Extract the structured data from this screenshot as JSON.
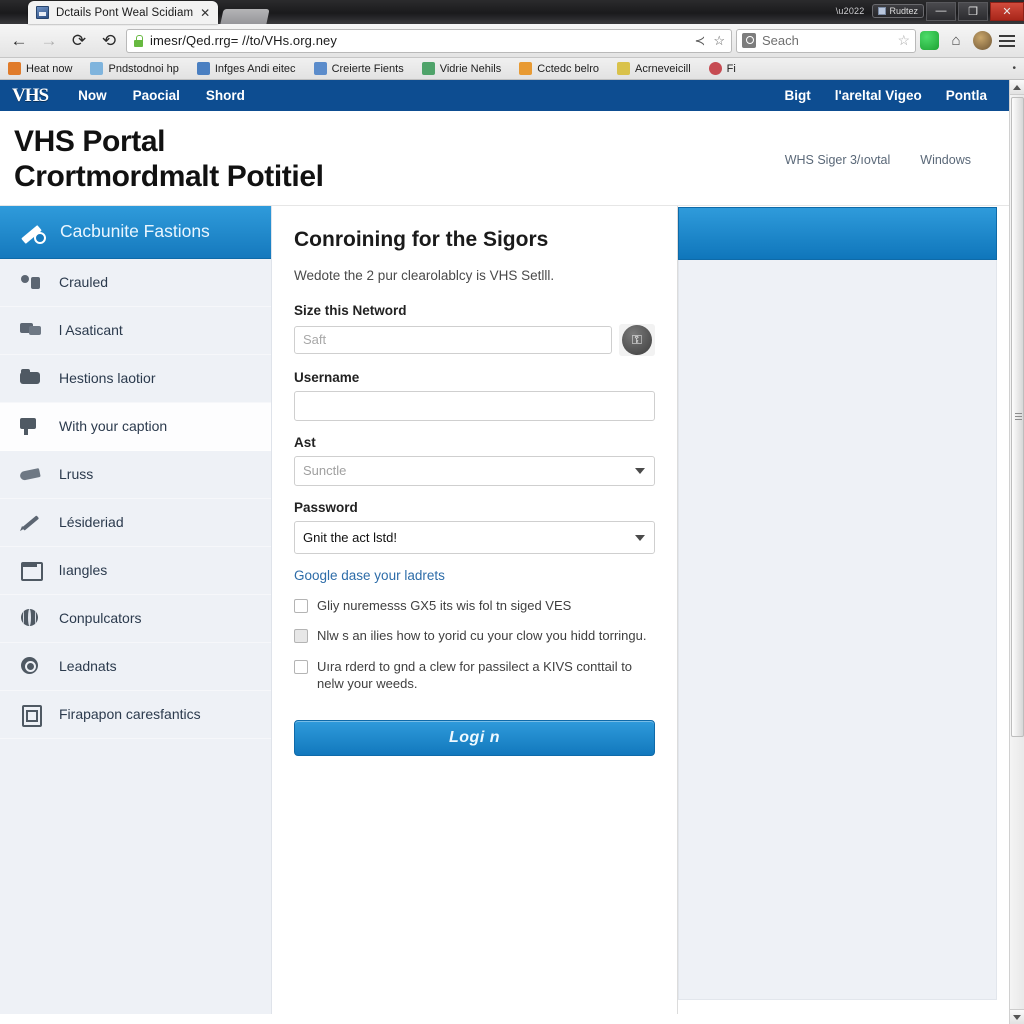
{
  "browser": {
    "tab": {
      "title": "Dctails Pont Weal Scidiam",
      "close_label": "✕",
      "favicon": "page-favicon"
    },
    "window_controls": {
      "status_text": "Rudtez",
      "minimize": "—",
      "maximize": "❐",
      "close": "✕"
    },
    "nav": {
      "back": "←",
      "forward": "→",
      "reload": "⟳",
      "stop": "⟲",
      "url": "imesr/Qed.rrg= //to/VHs.org.ney",
      "share": "≺",
      "bookmark_star": "☆"
    },
    "search": {
      "placeholder": "Seach",
      "value": "Seach",
      "star": "☆"
    },
    "toolbar_icons": [
      "shield-icon",
      "home-icon",
      "profile-icon",
      "menu-icon"
    ],
    "bookmarks": [
      {
        "label": "Heat now",
        "color": "#e07b2a"
      },
      {
        "label": "Pndstodnoi hp",
        "color": "#7fb4dd"
      },
      {
        "label": "Infges Andi eitec",
        "color": "#4a7fc1"
      },
      {
        "label": "Creierte Fients",
        "color": "#5b8ccb"
      },
      {
        "label": "Vidrie Nehils",
        "color": "#4fa36a"
      },
      {
        "label": "Cctedc belro",
        "color": "#e89a33"
      },
      {
        "label": "Acrneveicill",
        "color": "#d9c24b"
      },
      {
        "label": "Fi",
        "color": "#c64b52"
      }
    ],
    "bookmark_overflow": "•"
  },
  "site": {
    "topnav": {
      "brand": "VHS",
      "left_links": [
        "Now",
        "Paocial",
        "Shord"
      ],
      "right_links": [
        "Bigt",
        "l'areltal Vigeo",
        "Pontla"
      ]
    },
    "header": {
      "title_line1": "VHS Portal",
      "title_line2": "Crortmordmalt Potitiel",
      "links": [
        "WHS Siger 3/ıovtal",
        "Windows"
      ]
    }
  },
  "sidebar": {
    "header_title": "Cacbunite Fastions",
    "header_icon": "pencil-icon",
    "items": [
      {
        "label": "Crauled",
        "icon": "users-icon",
        "glyph": "g-users",
        "active": false
      },
      {
        "label": "l Asaticant",
        "icon": "chat-icon",
        "glyph": "g-chat",
        "active": false
      },
      {
        "label": "Hestions laotior",
        "icon": "folder-icon",
        "glyph": "g-folder",
        "active": false
      },
      {
        "label": "With your caption",
        "icon": "mailbox-icon",
        "glyph": "g-mailbox",
        "active": true
      },
      {
        "label": "Lruss",
        "icon": "hand-icon",
        "glyph": "g-hand",
        "active": false
      },
      {
        "label": "Lésideriad",
        "icon": "pen-icon",
        "glyph": "g-pen",
        "active": false
      },
      {
        "label": "lıangles",
        "icon": "window-icon",
        "glyph": "g-window",
        "active": false
      },
      {
        "label": "Conpulcators",
        "icon": "globe-icon",
        "glyph": "g-globe",
        "active": false
      },
      {
        "label": "Leadnats",
        "icon": "search-icon",
        "glyph": "g-search",
        "active": false
      },
      {
        "label": "Firapapon caresfantics",
        "icon": "document-icon",
        "glyph": "g-doc",
        "active": false
      }
    ]
  },
  "form": {
    "title": "Conroining for the Sigors",
    "subtitle": "Wedote the 2 pur clearolablcy is VHS Setlll.",
    "network_label": "Size this Netword",
    "network_placeholder": "Saft",
    "network_value": "",
    "network_button_icon": "key-icon",
    "username_label": "Username",
    "username_placeholder": "",
    "username_value": "",
    "ast_label": "Ast",
    "ast_value": "Sunctle",
    "password_label": "Password",
    "password_value": "Gnit the act lstd!",
    "help_link": "Google dase your ladrets",
    "checkboxes": [
      {
        "label": "Gliy nuremesss GX5 its wis fol tn siged VES",
        "checked": false,
        "style": "white"
      },
      {
        "label": "Nlw s an ilies how to yorid cu your clow you hidd torringu.",
        "checked": false,
        "style": "grey"
      },
      {
        "label": "Uıra rderd to gnd a clew for passilect a KIVS conttail to nelw your weeds.",
        "checked": false,
        "style": "white"
      }
    ],
    "submit_label": "Logi n"
  },
  "right_panel": {
    "header_title": ""
  },
  "scrollbar": {
    "up_arrow": "▲",
    "down_arrow": "▼"
  },
  "colors": {
    "topnav_blue": "#0d4d91",
    "accent_blue": "#1579bd",
    "sidebar_bg": "#eef1f6",
    "link_blue": "#2d6ca8"
  }
}
